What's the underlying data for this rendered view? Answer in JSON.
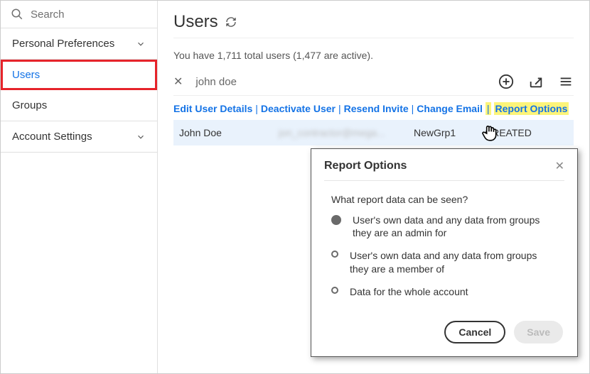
{
  "sidebar": {
    "search_label": "Search",
    "items": [
      {
        "label": "Personal Preferences",
        "expandable": true
      },
      {
        "label": "Users",
        "active": true
      },
      {
        "label": "Groups"
      },
      {
        "label": "Account Settings",
        "expandable": true
      }
    ]
  },
  "page": {
    "title": "Users",
    "count_text": "You have 1,711 total users (1,477 are active).",
    "filter_query": "john doe"
  },
  "actions": {
    "edit": "Edit User Details",
    "deactivate": "Deactivate User",
    "resend": "Resend Invite",
    "change_email": "Change Email",
    "report_options": "Report Options"
  },
  "row": {
    "name": "John Doe",
    "email_masked": "jon_contractor@mega...",
    "group": "NewGrp1",
    "status": "CREATED"
  },
  "modal": {
    "title": "Report Options",
    "question": "What report data can be seen?",
    "options": [
      "User's own data and any data from groups they are an admin for",
      "User's own data and any data from groups they are a member of",
      "Data for the whole account"
    ],
    "cancel": "Cancel",
    "save": "Save"
  }
}
